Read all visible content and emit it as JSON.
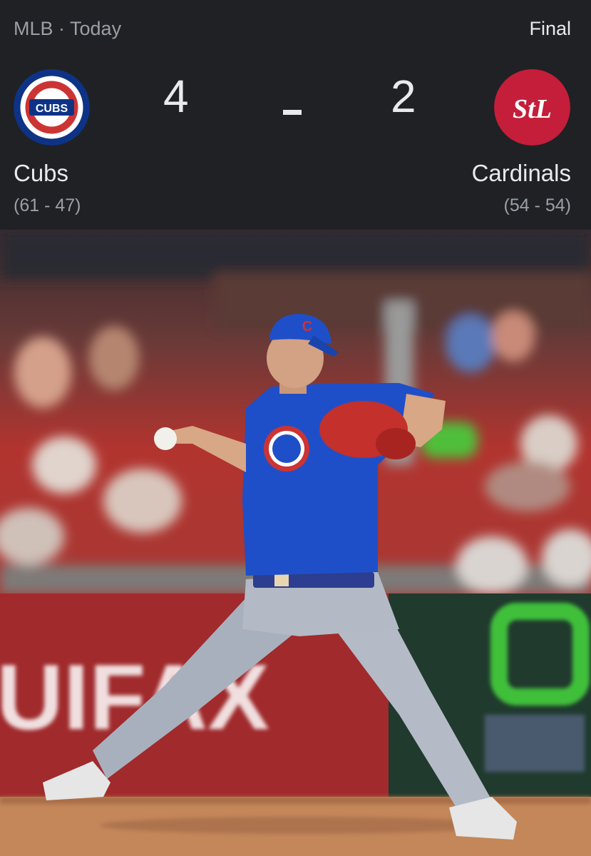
{
  "header": {
    "league_label": "MLB · Today",
    "status": "Final"
  },
  "home_team": {
    "name": "Cubs",
    "record": "(61 - 47)",
    "score": "4",
    "logo_text": "CUBS",
    "logo_colors": {
      "outer": "#0e3386",
      "ring": "#ffffff",
      "inner": "#cc3433"
    }
  },
  "away_team": {
    "name": "Cardinals",
    "record": "(54 - 54)",
    "score": "2",
    "logo_text": "StL",
    "logo_colors": {
      "bg": "#c41e3a",
      "letter": "#ffffff"
    }
  },
  "photo": {
    "banner_text": "UIFAX",
    "colors": {
      "stands": "#b2342f",
      "jersey": "#1f4fc8",
      "pants": "#a9b0bd",
      "dirt": "#c4875a",
      "wall": "#a02a2c"
    }
  }
}
